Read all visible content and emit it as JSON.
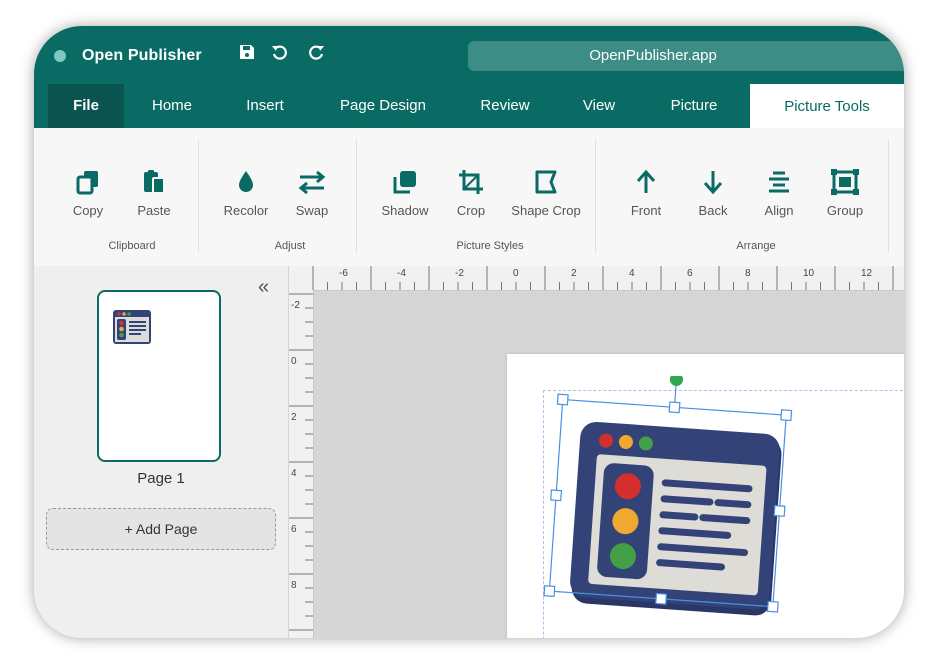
{
  "app": {
    "name": "Open Publisher",
    "url": "OpenPublisher.app"
  },
  "quick_access": {
    "save_icon": "save-icon",
    "undo_icon": "undo-icon",
    "redo_icon": "redo-icon"
  },
  "tabs": [
    {
      "label": "File"
    },
    {
      "label": "Home"
    },
    {
      "label": "Insert"
    },
    {
      "label": "Page Design"
    },
    {
      "label": "Review"
    },
    {
      "label": "View"
    },
    {
      "label": "Picture"
    },
    {
      "label": "Picture Tools"
    }
  ],
  "active_tab": "Picture Tools",
  "ribbon": {
    "groups": [
      {
        "label": "Clipboard",
        "tools": [
          {
            "label": "Copy",
            "icon": "copy-icon"
          },
          {
            "label": "Paste",
            "icon": "paste-icon"
          }
        ]
      },
      {
        "label": "Adjust",
        "tools": [
          {
            "label": "Recolor",
            "icon": "recolor-icon"
          },
          {
            "label": "Swap",
            "icon": "swap-icon"
          }
        ]
      },
      {
        "label": "Picture Styles",
        "tools": [
          {
            "label": "Shadow",
            "icon": "shadow-icon"
          },
          {
            "label": "Crop",
            "icon": "crop-icon"
          },
          {
            "label": "Shape Crop",
            "icon": "shape-crop-icon"
          }
        ]
      },
      {
        "label": "Arrange",
        "tools": [
          {
            "label": "Front",
            "icon": "arrow-up-icon"
          },
          {
            "label": "Back",
            "icon": "arrow-down-icon"
          },
          {
            "label": "Align",
            "icon": "align-icon"
          },
          {
            "label": "Group",
            "icon": "group-icon"
          }
        ]
      }
    ]
  },
  "pages_panel": {
    "collapse_glyph": "«",
    "pages": [
      {
        "label": "Page 1"
      }
    ],
    "add_page_label": "+ Add Page"
  },
  "rulers": {
    "horizontal_labels": [
      "-6",
      "-4",
      "-2",
      "0",
      "2",
      "4",
      "6",
      "8",
      "10",
      "12"
    ],
    "vertical_labels": [
      "-2",
      "0",
      "2",
      "4",
      "6",
      "8"
    ]
  },
  "colors": {
    "brand": "#0a6b64",
    "brand_dark": "#0a534e",
    "selection": "#4a90e2",
    "rotate_handle": "#2fa84f"
  },
  "picture": {
    "icon": "browser-window-illustration"
  }
}
